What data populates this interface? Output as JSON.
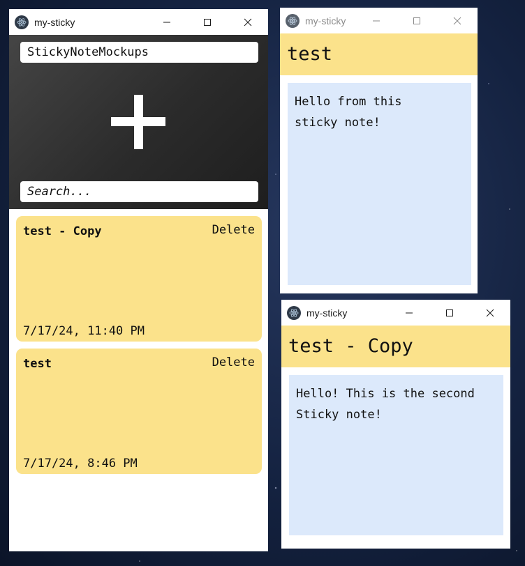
{
  "windows": {
    "main": {
      "title": "my-sticky",
      "app_name": "StickyNoteMockups",
      "search_placeholder": "Search...",
      "notes": [
        {
          "title": "test - Copy",
          "delete_label": "Delete",
          "date": "7/17/24, 11:40 PM"
        },
        {
          "title": "test",
          "delete_label": "Delete",
          "date": "7/17/24, 8:46 PM"
        }
      ]
    },
    "sticky1": {
      "title": "my-sticky",
      "heading": "test",
      "body": "Hello from this\nsticky note!"
    },
    "sticky2": {
      "title": "my-sticky",
      "heading": "test - Copy",
      "body": "Hello! This is the second\nSticky note!"
    }
  },
  "colors": {
    "note_yellow": "#fbe28b",
    "body_blue": "#dce9fb",
    "hero_dark": "#2b2b2b"
  },
  "icons": {
    "app": "electron-atom-icon",
    "minimize": "minimize-icon",
    "maximize": "maximize-icon",
    "close": "close-icon",
    "add": "plus-icon"
  }
}
